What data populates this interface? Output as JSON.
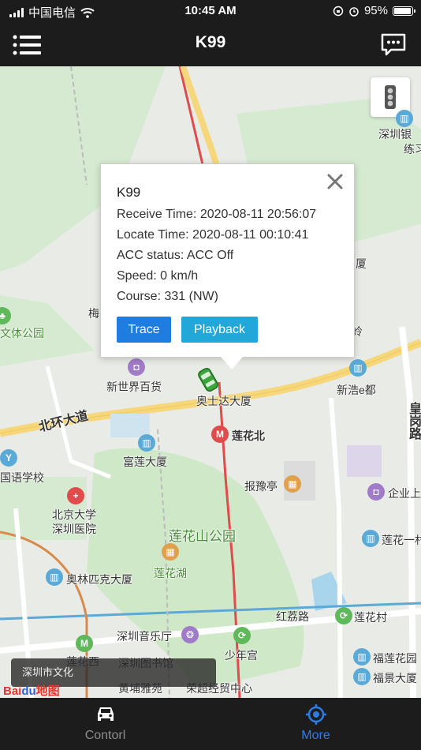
{
  "status_bar": {
    "carrier": "中国电信",
    "time": "10:45 AM",
    "battery": "95%",
    "battery_level": 0.95
  },
  "nav": {
    "title": "K99",
    "menu_icon": "menu-icon",
    "message_icon": "chat-bubble-icon"
  },
  "map": {
    "traffic_icon": "traffic-light-icon",
    "labels": {
      "shenzhen_yin": "深圳银",
      "lian": "练习",
      "mei": "梅",
      "xia": "厦",
      "ling": "岭",
      "wenti_park": "文体公园",
      "xinshijie": "新世界百货",
      "aoshida": "奥士达大厦",
      "xinhao": "新浩e都",
      "beihuan": "北环大道",
      "lianhua_north": "莲花北",
      "huang_gang": "皇岗路",
      "fulian": "富莲大厦",
      "guoyu_school": "国语学校",
      "baoyuting": "报豫亭",
      "qiye": "企业上",
      "pku_hospital_1": "北京大学",
      "pku_hospital_2": "深圳医院",
      "lianhuashan_park": "莲花山公园",
      "lianhua_yi": "莲花一村",
      "lianhua_lake": "莲花湖",
      "olympic": "奥林匹克大厦",
      "honglizhi": "红荔路",
      "lianhua_village": "莲花村",
      "concert_hall": "深圳音乐厅",
      "shaoniangong": "少年宫",
      "lianhua_west": "莲花西",
      "library": "深圳图书馆",
      "futian_garden": "福莲花园",
      "fujing": "福景大厦",
      "huangpu": "黄埔雅苑",
      "rongchao": "荣超经贸中心",
      "shenzhen_city": "深圳市文化"
    },
    "baidu_logo": [
      "Bai",
      "du",
      "地图"
    ]
  },
  "popup": {
    "device": "K99",
    "receive_time": "Receive Time: 2020-08-11 20:56:07",
    "locate_time": "Locate Time: 2020-08-11 00:10:41",
    "acc_status": "ACC status: ACC Off",
    "speed": "Speed: 0 km/h",
    "course": "Course: 331 (NW)",
    "trace_label": "Trace",
    "playback_label": "Playback",
    "close_icon": "close-icon"
  },
  "tabs": {
    "control_label": "Contorl",
    "control_icon": "car-icon",
    "more_label": "More",
    "more_icon": "location-target-icon",
    "active": "More",
    "active_color": "#2f7de4",
    "inactive_color": "#8e8e8e"
  },
  "colors": {
    "bar_bg": "#1c1c1c",
    "trace_btn": "#1f7de0",
    "playback_btn": "#22a8d8",
    "map_bg": "#e9ebe6",
    "park": "#cfe8c8",
    "road_yellow": "#f6d77c",
    "metro_red": "#e04b4b"
  }
}
